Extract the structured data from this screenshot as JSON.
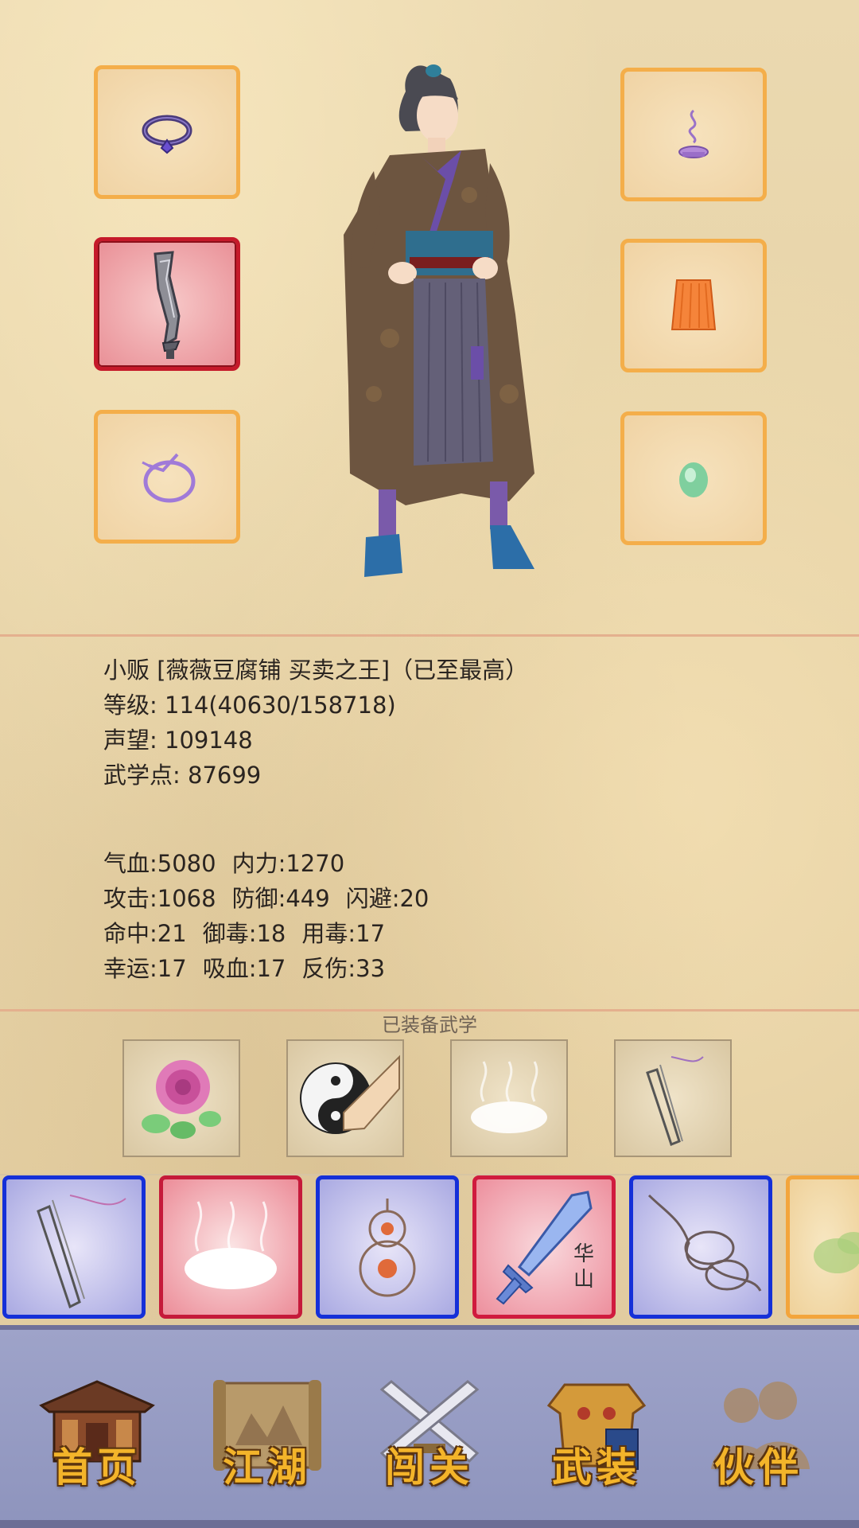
{
  "character": {
    "title_line": "小贩 [薇薇豆腐铺 买卖之王]（已至最高）",
    "level_label": "等级:",
    "level_value": "114(40630/158718)",
    "fame_label": "声望:",
    "fame_value": "109148",
    "martial_points_label": "武学点:",
    "martial_points_value": "87699"
  },
  "stats": {
    "row1": [
      "气血:5080",
      "内力:1270"
    ],
    "row2": [
      "攻击:1068",
      "防御:449",
      "闪避:20"
    ],
    "row3": [
      "命中:21",
      "御毒:18",
      "用毒:17"
    ],
    "row4": [
      "幸运:17",
      "吸血:17",
      "反伤:33"
    ]
  },
  "equipment_slots": {
    "left": [
      {
        "icon": "ring-icon",
        "rarity": "normal"
      },
      {
        "icon": "saber-icon",
        "rarity": "red"
      },
      {
        "icon": "bracelet-icon",
        "rarity": "normal"
      }
    ],
    "right": [
      {
        "icon": "incense-icon",
        "rarity": "normal"
      },
      {
        "icon": "robe-icon",
        "rarity": "normal"
      },
      {
        "icon": "jade-icon",
        "rarity": "normal"
      }
    ]
  },
  "equipped_martial": {
    "title": "已装备武学",
    "skills": [
      "peony-skill-icon",
      "taiji-fist-skill-icon",
      "mist-skill-icon",
      "blade-skill-icon"
    ]
  },
  "skill_cards": [
    {
      "icon": "blade-skill-icon",
      "color": "blue"
    },
    {
      "icon": "mist-skill-icon",
      "color": "red"
    },
    {
      "icon": "gourd-skill-icon",
      "color": "blue"
    },
    {
      "icon": "sword-skill-icon",
      "color": "red",
      "text": "华山"
    },
    {
      "icon": "fist-skill-icon",
      "color": "blue"
    },
    {
      "icon": "herb-skill-icon",
      "color": "orange"
    }
  ],
  "nav": {
    "home": "首页",
    "jianghu": "江湖",
    "challenge": "闯关",
    "equipment": "武装",
    "partners": "伙伴"
  },
  "colors": {
    "slot_border": "#f4ae4a",
    "red_border": "#c51a2a",
    "blue_border": "#1530d8",
    "nav_bg": "#9ea3c9",
    "nav_text": "#f3b42a"
  }
}
